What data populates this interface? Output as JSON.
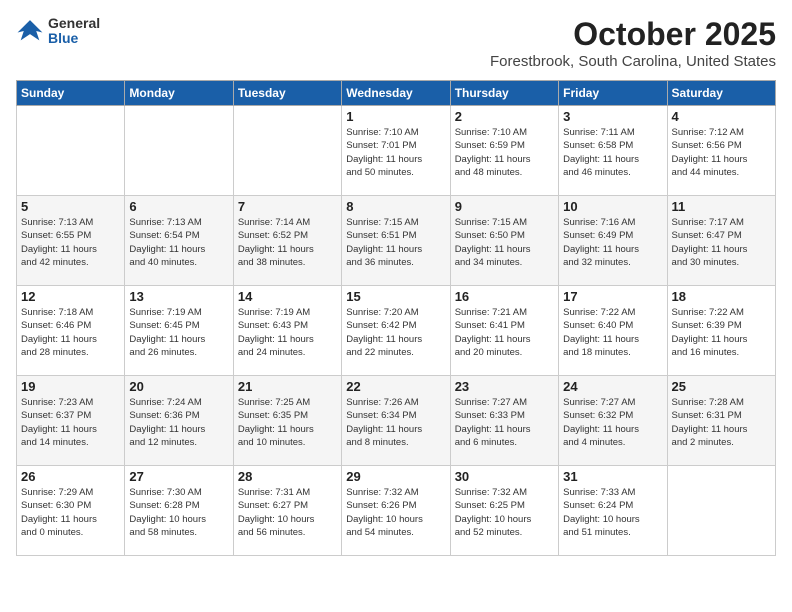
{
  "logo": {
    "general": "General",
    "blue": "Blue"
  },
  "title": "October 2025",
  "location": "Forestbrook, South Carolina, United States",
  "weekdays": [
    "Sunday",
    "Monday",
    "Tuesday",
    "Wednesday",
    "Thursday",
    "Friday",
    "Saturday"
  ],
  "weeks": [
    [
      {
        "day": "",
        "info": ""
      },
      {
        "day": "",
        "info": ""
      },
      {
        "day": "",
        "info": ""
      },
      {
        "day": "1",
        "info": "Sunrise: 7:10 AM\nSunset: 7:01 PM\nDaylight: 11 hours\nand 50 minutes."
      },
      {
        "day": "2",
        "info": "Sunrise: 7:10 AM\nSunset: 6:59 PM\nDaylight: 11 hours\nand 48 minutes."
      },
      {
        "day": "3",
        "info": "Sunrise: 7:11 AM\nSunset: 6:58 PM\nDaylight: 11 hours\nand 46 minutes."
      },
      {
        "day": "4",
        "info": "Sunrise: 7:12 AM\nSunset: 6:56 PM\nDaylight: 11 hours\nand 44 minutes."
      }
    ],
    [
      {
        "day": "5",
        "info": "Sunrise: 7:13 AM\nSunset: 6:55 PM\nDaylight: 11 hours\nand 42 minutes."
      },
      {
        "day": "6",
        "info": "Sunrise: 7:13 AM\nSunset: 6:54 PM\nDaylight: 11 hours\nand 40 minutes."
      },
      {
        "day": "7",
        "info": "Sunrise: 7:14 AM\nSunset: 6:52 PM\nDaylight: 11 hours\nand 38 minutes."
      },
      {
        "day": "8",
        "info": "Sunrise: 7:15 AM\nSunset: 6:51 PM\nDaylight: 11 hours\nand 36 minutes."
      },
      {
        "day": "9",
        "info": "Sunrise: 7:15 AM\nSunset: 6:50 PM\nDaylight: 11 hours\nand 34 minutes."
      },
      {
        "day": "10",
        "info": "Sunrise: 7:16 AM\nSunset: 6:49 PM\nDaylight: 11 hours\nand 32 minutes."
      },
      {
        "day": "11",
        "info": "Sunrise: 7:17 AM\nSunset: 6:47 PM\nDaylight: 11 hours\nand 30 minutes."
      }
    ],
    [
      {
        "day": "12",
        "info": "Sunrise: 7:18 AM\nSunset: 6:46 PM\nDaylight: 11 hours\nand 28 minutes."
      },
      {
        "day": "13",
        "info": "Sunrise: 7:19 AM\nSunset: 6:45 PM\nDaylight: 11 hours\nand 26 minutes."
      },
      {
        "day": "14",
        "info": "Sunrise: 7:19 AM\nSunset: 6:43 PM\nDaylight: 11 hours\nand 24 minutes."
      },
      {
        "day": "15",
        "info": "Sunrise: 7:20 AM\nSunset: 6:42 PM\nDaylight: 11 hours\nand 22 minutes."
      },
      {
        "day": "16",
        "info": "Sunrise: 7:21 AM\nSunset: 6:41 PM\nDaylight: 11 hours\nand 20 minutes."
      },
      {
        "day": "17",
        "info": "Sunrise: 7:22 AM\nSunset: 6:40 PM\nDaylight: 11 hours\nand 18 minutes."
      },
      {
        "day": "18",
        "info": "Sunrise: 7:22 AM\nSunset: 6:39 PM\nDaylight: 11 hours\nand 16 minutes."
      }
    ],
    [
      {
        "day": "19",
        "info": "Sunrise: 7:23 AM\nSunset: 6:37 PM\nDaylight: 11 hours\nand 14 minutes."
      },
      {
        "day": "20",
        "info": "Sunrise: 7:24 AM\nSunset: 6:36 PM\nDaylight: 11 hours\nand 12 minutes."
      },
      {
        "day": "21",
        "info": "Sunrise: 7:25 AM\nSunset: 6:35 PM\nDaylight: 11 hours\nand 10 minutes."
      },
      {
        "day": "22",
        "info": "Sunrise: 7:26 AM\nSunset: 6:34 PM\nDaylight: 11 hours\nand 8 minutes."
      },
      {
        "day": "23",
        "info": "Sunrise: 7:27 AM\nSunset: 6:33 PM\nDaylight: 11 hours\nand 6 minutes."
      },
      {
        "day": "24",
        "info": "Sunrise: 7:27 AM\nSunset: 6:32 PM\nDaylight: 11 hours\nand 4 minutes."
      },
      {
        "day": "25",
        "info": "Sunrise: 7:28 AM\nSunset: 6:31 PM\nDaylight: 11 hours\nand 2 minutes."
      }
    ],
    [
      {
        "day": "26",
        "info": "Sunrise: 7:29 AM\nSunset: 6:30 PM\nDaylight: 11 hours\nand 0 minutes."
      },
      {
        "day": "27",
        "info": "Sunrise: 7:30 AM\nSunset: 6:28 PM\nDaylight: 10 hours\nand 58 minutes."
      },
      {
        "day": "28",
        "info": "Sunrise: 7:31 AM\nSunset: 6:27 PM\nDaylight: 10 hours\nand 56 minutes."
      },
      {
        "day": "29",
        "info": "Sunrise: 7:32 AM\nSunset: 6:26 PM\nDaylight: 10 hours\nand 54 minutes."
      },
      {
        "day": "30",
        "info": "Sunrise: 7:32 AM\nSunset: 6:25 PM\nDaylight: 10 hours\nand 52 minutes."
      },
      {
        "day": "31",
        "info": "Sunrise: 7:33 AM\nSunset: 6:24 PM\nDaylight: 10 hours\nand 51 minutes."
      },
      {
        "day": "",
        "info": ""
      }
    ]
  ]
}
